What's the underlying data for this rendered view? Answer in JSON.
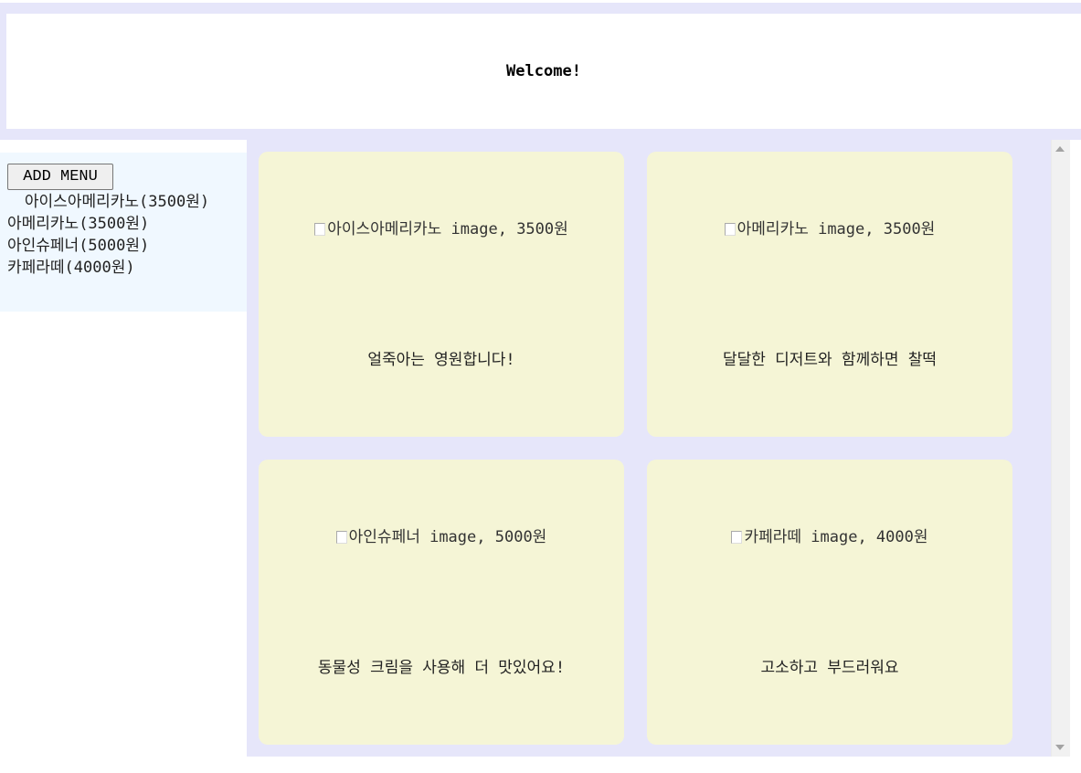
{
  "header": {
    "title": "Welcome!"
  },
  "sidebar": {
    "add_button": "ADD MENU",
    "items": [
      {
        "label": "아이스아메리카노(3500원)"
      },
      {
        "label": "아메리카노(3500원)"
      },
      {
        "label": "아인슈페너(5000원)"
      },
      {
        "label": "카페라떼(4000원)"
      }
    ]
  },
  "cards": [
    {
      "image_alt": "아이스아메리카노 image, 3500원",
      "description": "얼죽아는 영원합니다!"
    },
    {
      "image_alt": "아메리카노 image, 3500원",
      "description": "달달한 디저트와 함께하면 찰떡"
    },
    {
      "image_alt": "아인슈페너 image, 5000원",
      "description": "동물성 크림을 사용해 더 맛있어요!"
    },
    {
      "image_alt": "카페라떼 image, 4000원",
      "description": "고소하고 부드러워요"
    }
  ],
  "colors": {
    "header_band": "#e6e6fa",
    "sidebar_bg": "#f0f8ff",
    "card_bg": "#f5f5d6",
    "main_bg": "#e6e6fa"
  }
}
